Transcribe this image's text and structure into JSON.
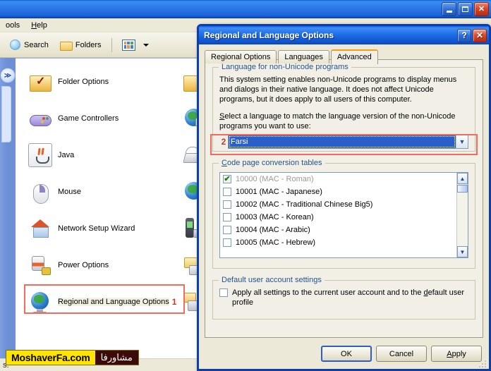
{
  "explorer": {
    "menus": [
      {
        "label": "ools",
        "accel": "",
        "name": "menu-tools"
      },
      {
        "label": "Help",
        "accel": "H",
        "name": "menu-help"
      }
    ],
    "toolbar": {
      "search_label": "Search",
      "folders_label": "Folders",
      "views_icon": "views-grid-icon",
      "views_caret": "caret-down-icon"
    },
    "window_buttons": {
      "minimize": "minimize-icon",
      "maximize": "maximize-icon",
      "close": "close-icon"
    },
    "items_col1": [
      {
        "label": "Folder Options",
        "icon": "folder-options-icon"
      },
      {
        "label": "Game Controllers",
        "icon": "game-controllers-icon"
      },
      {
        "label": "Java",
        "icon": "java-icon"
      },
      {
        "label": "Mouse",
        "icon": "mouse-icon"
      },
      {
        "label": "Network Setup Wizard",
        "icon": "network-setup-wizard-icon"
      },
      {
        "label": "Power Options",
        "icon": "power-options-icon"
      },
      {
        "label": "Regional and Language Options",
        "icon": "regional-options-icon",
        "step": "1",
        "highlighted": true
      }
    ],
    "items_col2": [
      {
        "icon": "folder-icon"
      },
      {
        "icon": "internet-options-icon"
      },
      {
        "icon": "keyboard-icon"
      },
      {
        "icon": "network-connections-icon"
      },
      {
        "icon": "phone-modem-icon"
      },
      {
        "icon": "printers-faxes-icon"
      },
      {
        "icon": "scanners-cameras-icon"
      }
    ],
    "status_text": "s."
  },
  "watermark": {
    "latin": "MoshaverFa.com",
    "persian": "مشاورفا"
  },
  "dialog": {
    "title": "Regional and Language Options",
    "buttons": {
      "help": "?",
      "close": "✕"
    },
    "tabs": [
      {
        "label": "Regional Options",
        "active": false
      },
      {
        "label": "Languages",
        "active": false
      },
      {
        "label": "Advanced",
        "active": true
      }
    ],
    "group_language": {
      "title": "Language for non-Unicode programs",
      "paragraph1": "This system setting enables non-Unicode programs to display menus and dialogs in their native language. It does not affect Unicode programs, but it does apply to all users of this computer.",
      "paragraph2_pre": "S",
      "paragraph2": "elect a language to match the language version of the non-Unicode programs you want to use:",
      "combo_value": "Farsi",
      "combo_arrow": "chevron-down-icon",
      "step": "2"
    },
    "group_codepage": {
      "title_accel": "C",
      "title": "ode page conversion tables",
      "rows": [
        {
          "label": "10000 (MAC - Roman)",
          "checked": true,
          "disabled": true
        },
        {
          "label": "10001 (MAC - Japanese)",
          "checked": false,
          "disabled": false
        },
        {
          "label": "10002 (MAC - Traditional Chinese Big5)",
          "checked": false,
          "disabled": false
        },
        {
          "label": "10003 (MAC - Korean)",
          "checked": false,
          "disabled": false
        },
        {
          "label": "10004 (MAC - Arabic)",
          "checked": false,
          "disabled": false
        },
        {
          "label": "10005 (MAC - Hebrew)",
          "checked": false,
          "disabled": false
        }
      ],
      "scroll_up": "scroll-up-icon",
      "scroll_down": "scroll-down-icon"
    },
    "group_default": {
      "title": "Default user account settings",
      "checkbox_label_pre": "Apply all settings to the current user account and to the ",
      "checkbox_label_accel": "d",
      "checkbox_label_post": "efault user profile",
      "checked": false
    },
    "footer": {
      "ok": "OK",
      "cancel": "Cancel",
      "apply_accel": "A",
      "apply_rest": "pply"
    }
  },
  "colors": {
    "title_blue": "#1f6fe8",
    "accent_orange": "#f59c1a",
    "highlight_red": "#f06c5e",
    "step_red": "#c0392b",
    "selection_blue": "#2a5fc9",
    "watermark_yellow": "#ffe400",
    "watermark_dark": "#3d0a0a"
  }
}
